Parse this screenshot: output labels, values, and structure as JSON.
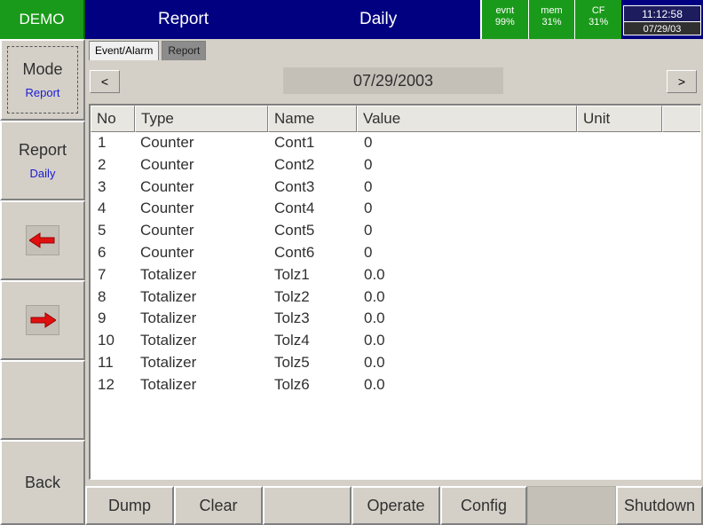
{
  "topbar": {
    "demo": "DEMO",
    "title": "Report",
    "subtitle": "Daily",
    "status": [
      {
        "label": "evnt",
        "value": "99%"
      },
      {
        "label": "mem",
        "value": "31%"
      },
      {
        "label": "CF",
        "value": "31%"
      }
    ],
    "time": "11:12:58",
    "date": "07/29/03"
  },
  "sidebar": {
    "mode": {
      "label": "Mode",
      "value": "Report"
    },
    "report": {
      "label": "Report",
      "value": "Daily"
    },
    "prev_icon": "red-left-arrow-icon",
    "next_icon": "red-right-arrow-icon",
    "back": "Back"
  },
  "tabs": [
    {
      "label": "Event/Alarm",
      "active": false
    },
    {
      "label": "Report",
      "active": true
    }
  ],
  "nav": {
    "prev": "<",
    "next": ">",
    "date": "07/29/2003"
  },
  "table": {
    "columns": [
      "No",
      "Type",
      "Name",
      "Value",
      "Unit"
    ],
    "rows": [
      [
        "1",
        "Counter",
        "Cont1",
        "0",
        ""
      ],
      [
        "2",
        "Counter",
        "Cont2",
        "0",
        ""
      ],
      [
        "3",
        "Counter",
        "Cont3",
        "0",
        ""
      ],
      [
        "4",
        "Counter",
        "Cont4",
        "0",
        ""
      ],
      [
        "5",
        "Counter",
        "Cont5",
        "0",
        ""
      ],
      [
        "6",
        "Counter",
        "Cont6",
        "0",
        ""
      ],
      [
        "7",
        "Totalizer",
        "Tolz1",
        "0.0",
        ""
      ],
      [
        "8",
        "Totalizer",
        "Tolz2",
        "0.0",
        ""
      ],
      [
        "9",
        "Totalizer",
        "Tolz3",
        "0.0",
        ""
      ],
      [
        "10",
        "Totalizer",
        "Tolz4",
        "0.0",
        ""
      ],
      [
        "11",
        "Totalizer",
        "Tolz5",
        "0.0",
        ""
      ],
      [
        "12",
        "Totalizer",
        "Tolz6",
        "0.0",
        ""
      ]
    ]
  },
  "bottom": {
    "dump": "Dump",
    "clear": "Clear",
    "operate": "Operate",
    "config": "Config",
    "shutdown": "Shutdown"
  },
  "colors": {
    "topbar": "#000080",
    "demo": "#1a9a1a",
    "accent_text": "#1a1ad6",
    "arrow": "#e01010"
  }
}
